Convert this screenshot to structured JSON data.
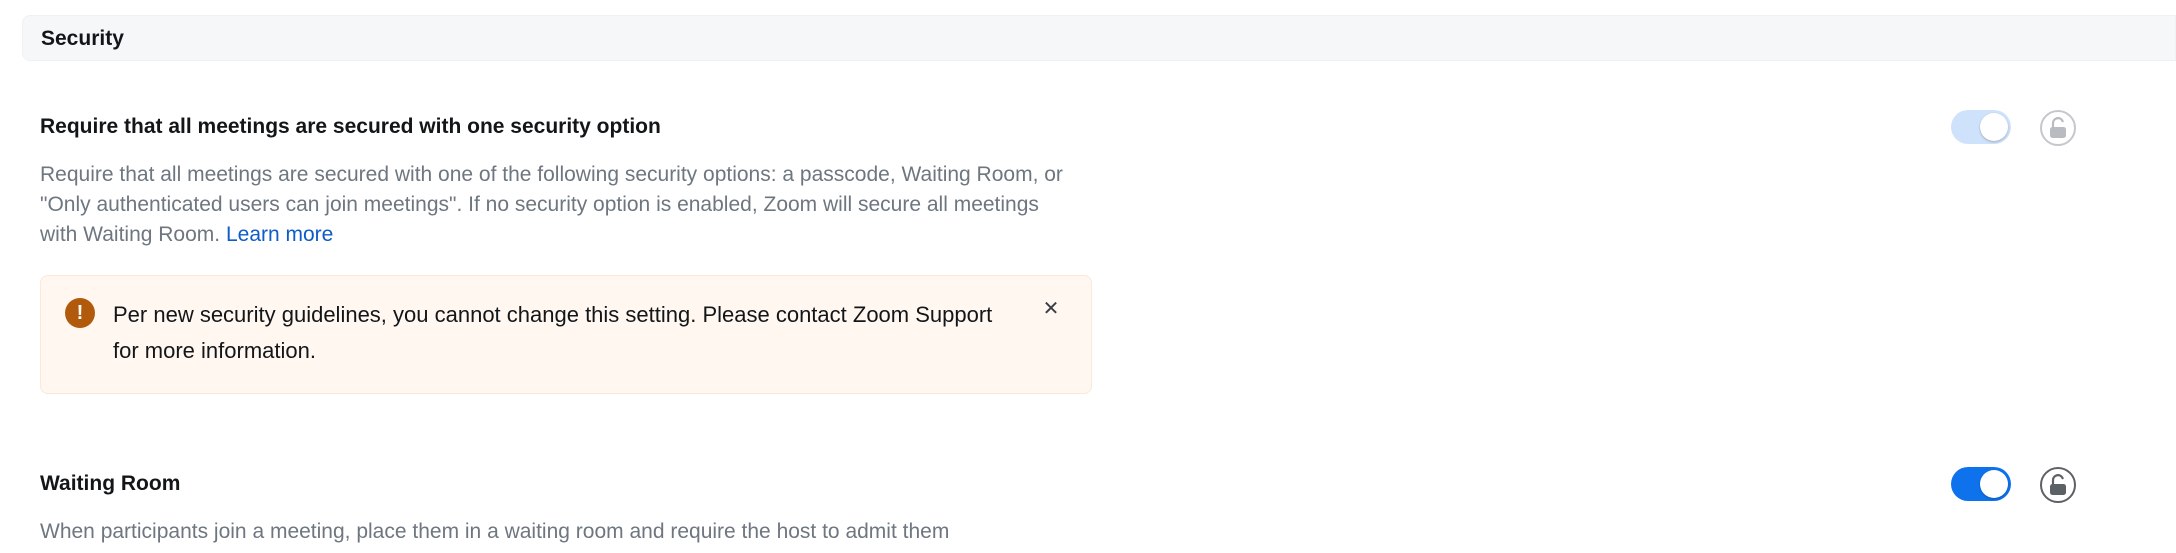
{
  "section": {
    "title": "Security"
  },
  "settings": [
    {
      "title": "Require that all meetings are secured with one security option",
      "description": "Require that all meetings are secured with one of the following security options: a passcode, Waiting Room, or \"Only authenticated users can join meetings\". If no security option is enabled, Zoom will secure all meetings with Waiting Room.",
      "link_text": "Learn more",
      "toggle_on": true,
      "toggle_disabled": true,
      "lock_icon": "unlocked-padlock-icon",
      "alert": {
        "icon": "warning-exclamation-icon",
        "message": "Per new security guidelines, you cannot change this setting. Please contact Zoom Support for more information.",
        "close_icon": "close-x-icon"
      }
    },
    {
      "title": "Waiting Room",
      "description": "When participants join a meeting, place them in a waiting room and require the host to admit them",
      "toggle_on": true,
      "toggle_disabled": false,
      "lock_icon": "unlocked-padlock-icon"
    }
  ],
  "colors": {
    "accent": "#0e72ed",
    "accent_disabled": "#cfe2fb",
    "link": "#0e5cc9",
    "warning": "#b25a0b",
    "alert_bg": "#fff7f0"
  }
}
